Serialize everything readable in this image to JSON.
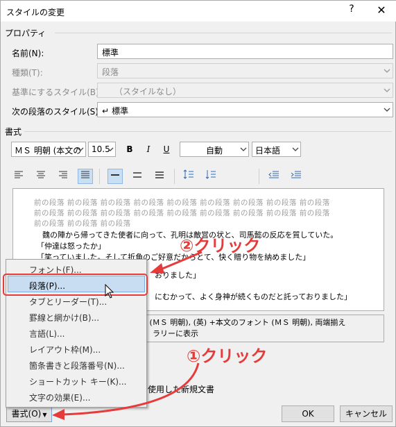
{
  "window": {
    "title": "スタイルの変更",
    "help": "?",
    "close": "✕"
  },
  "properties": {
    "group": "プロパティ",
    "name_label": "名前(N):",
    "name_value": "標準",
    "type_label": "種類(T):",
    "type_value": "段落",
    "base_label": "基準にするスタイル(B):",
    "base_value": "（スタイルなし）",
    "next_label": "次の段落のスタイル(S):",
    "next_value": "標準"
  },
  "format": {
    "group": "書式",
    "font_value": "ＭＳ 明朝 (本文の",
    "size_value": "10.5",
    "bold": "B",
    "italic": "I",
    "underline": "U",
    "color_value": "自動",
    "lang_value": "日本語"
  },
  "preview": {
    "prev_line": "前の段落 前の段落 前の段落 前の段落 前の段落 前の段落 前の段落 前の段落 前の段落",
    "prev_last": "前の段落 前の段落 前の段落",
    "line1": "魏の陣から帰ってきた使者に向って、孔明は敵営の状と、司馬懿の反応を質していた。",
    "line2": "「仲達は怒ったか」",
    "line3": "「笑っていました。そして折角のご好意だからとて、快く贈り物を納めました」",
    "line4_tail": "おりました」",
    "line5_tail": "にむかって、よく身神が続くものだと託っておりました」"
  },
  "description": {
    "line1": "語 (ＭＳ 明朝), (英) +本文のフォント (ＭＳ 明朝), 両端揃え",
    "line2": "ラリーに表示"
  },
  "template_text": "を使用した新規文書",
  "menu": {
    "items": [
      "フォント(F)...",
      "段落(P)...",
      "タブとリーダー(T)...",
      "罫線と網かけ(B)...",
      "言語(L)...",
      "レイアウト枠(M)...",
      "箇条書きと段落番号(N)...",
      "ショートカット キー(K)...",
      "文字の効果(E)..."
    ]
  },
  "buttons": {
    "format": "書式(O)",
    "ok": "OK",
    "cancel": "キャンセル"
  },
  "annotations": {
    "step2": "②クリック",
    "step1": "①クリック"
  },
  "colors": {
    "annotation_red": "#e53b3b",
    "highlight": "#c8dcf2"
  }
}
